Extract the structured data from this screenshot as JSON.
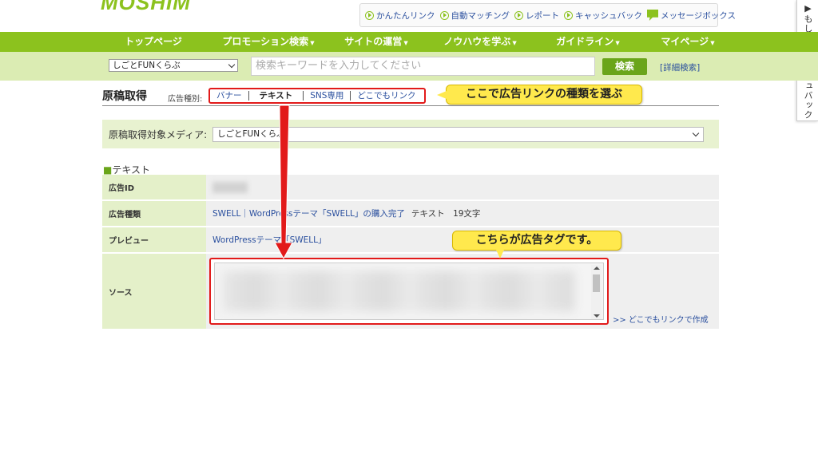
{
  "header": {
    "logo_text": "MOSHIM",
    "top_links": [
      {
        "label": "かんたんリンク",
        "icon": "play-icon"
      },
      {
        "label": "自動マッチング",
        "icon": "play-icon"
      },
      {
        "label": "レポート",
        "icon": "play-icon"
      },
      {
        "label": "キャッシュバック",
        "icon": "play-icon"
      },
      {
        "label": "メッセージボックス",
        "icon": "message-icon"
      }
    ]
  },
  "side_tab": {
    "label": "▶もしもキャッシュバック"
  },
  "nav": {
    "items": [
      "トップページ",
      "プロモーション検索",
      "サイトの運営",
      "ノウハウを学ぶ",
      "ガイドライン",
      "マイページ"
    ],
    "caret": "▼"
  },
  "search": {
    "media_selected": "しごとFUNくらぶ",
    "placeholder": "検索キーワードを入力してください",
    "button_label": "検索",
    "advanced_label": "[詳細検索]"
  },
  "page": {
    "title": "原稿取得",
    "ad_type_label": "広告種別:",
    "ad_types": [
      "バナー",
      "テキスト",
      "SNS専用",
      "どこでもリンク"
    ],
    "active_ad_type": "テキスト",
    "target_media_label": "原稿取得対象メディア:",
    "target_media_selected": "しごとFUNくらぶ",
    "section_title": "テキスト",
    "section_marker": "■"
  },
  "details": {
    "id_label": "広告ID",
    "type_label": "広告種類",
    "type_value_link": "SWELL｜WordPressテーマ「SWELL」の購入完了",
    "type_value_text": "テキスト　19文字",
    "preview_label": "プレビュー",
    "preview_link": "WordPressテーマ「SWELL」",
    "source_label": "ソース",
    "anywhere_link": ">> どこでもリンクで作成"
  },
  "annotations": {
    "callout_top": "ここで広告リンクの種類を選ぶ",
    "callout_source": "こちらが広告タグです。",
    "accent_red": "#e21a1a",
    "callout_yellow": "#ffe94d"
  },
  "colors": {
    "brand_green": "#8cc21e",
    "search_bar_bg": "#dbecb3",
    "link_blue": "#2a4f9e"
  }
}
